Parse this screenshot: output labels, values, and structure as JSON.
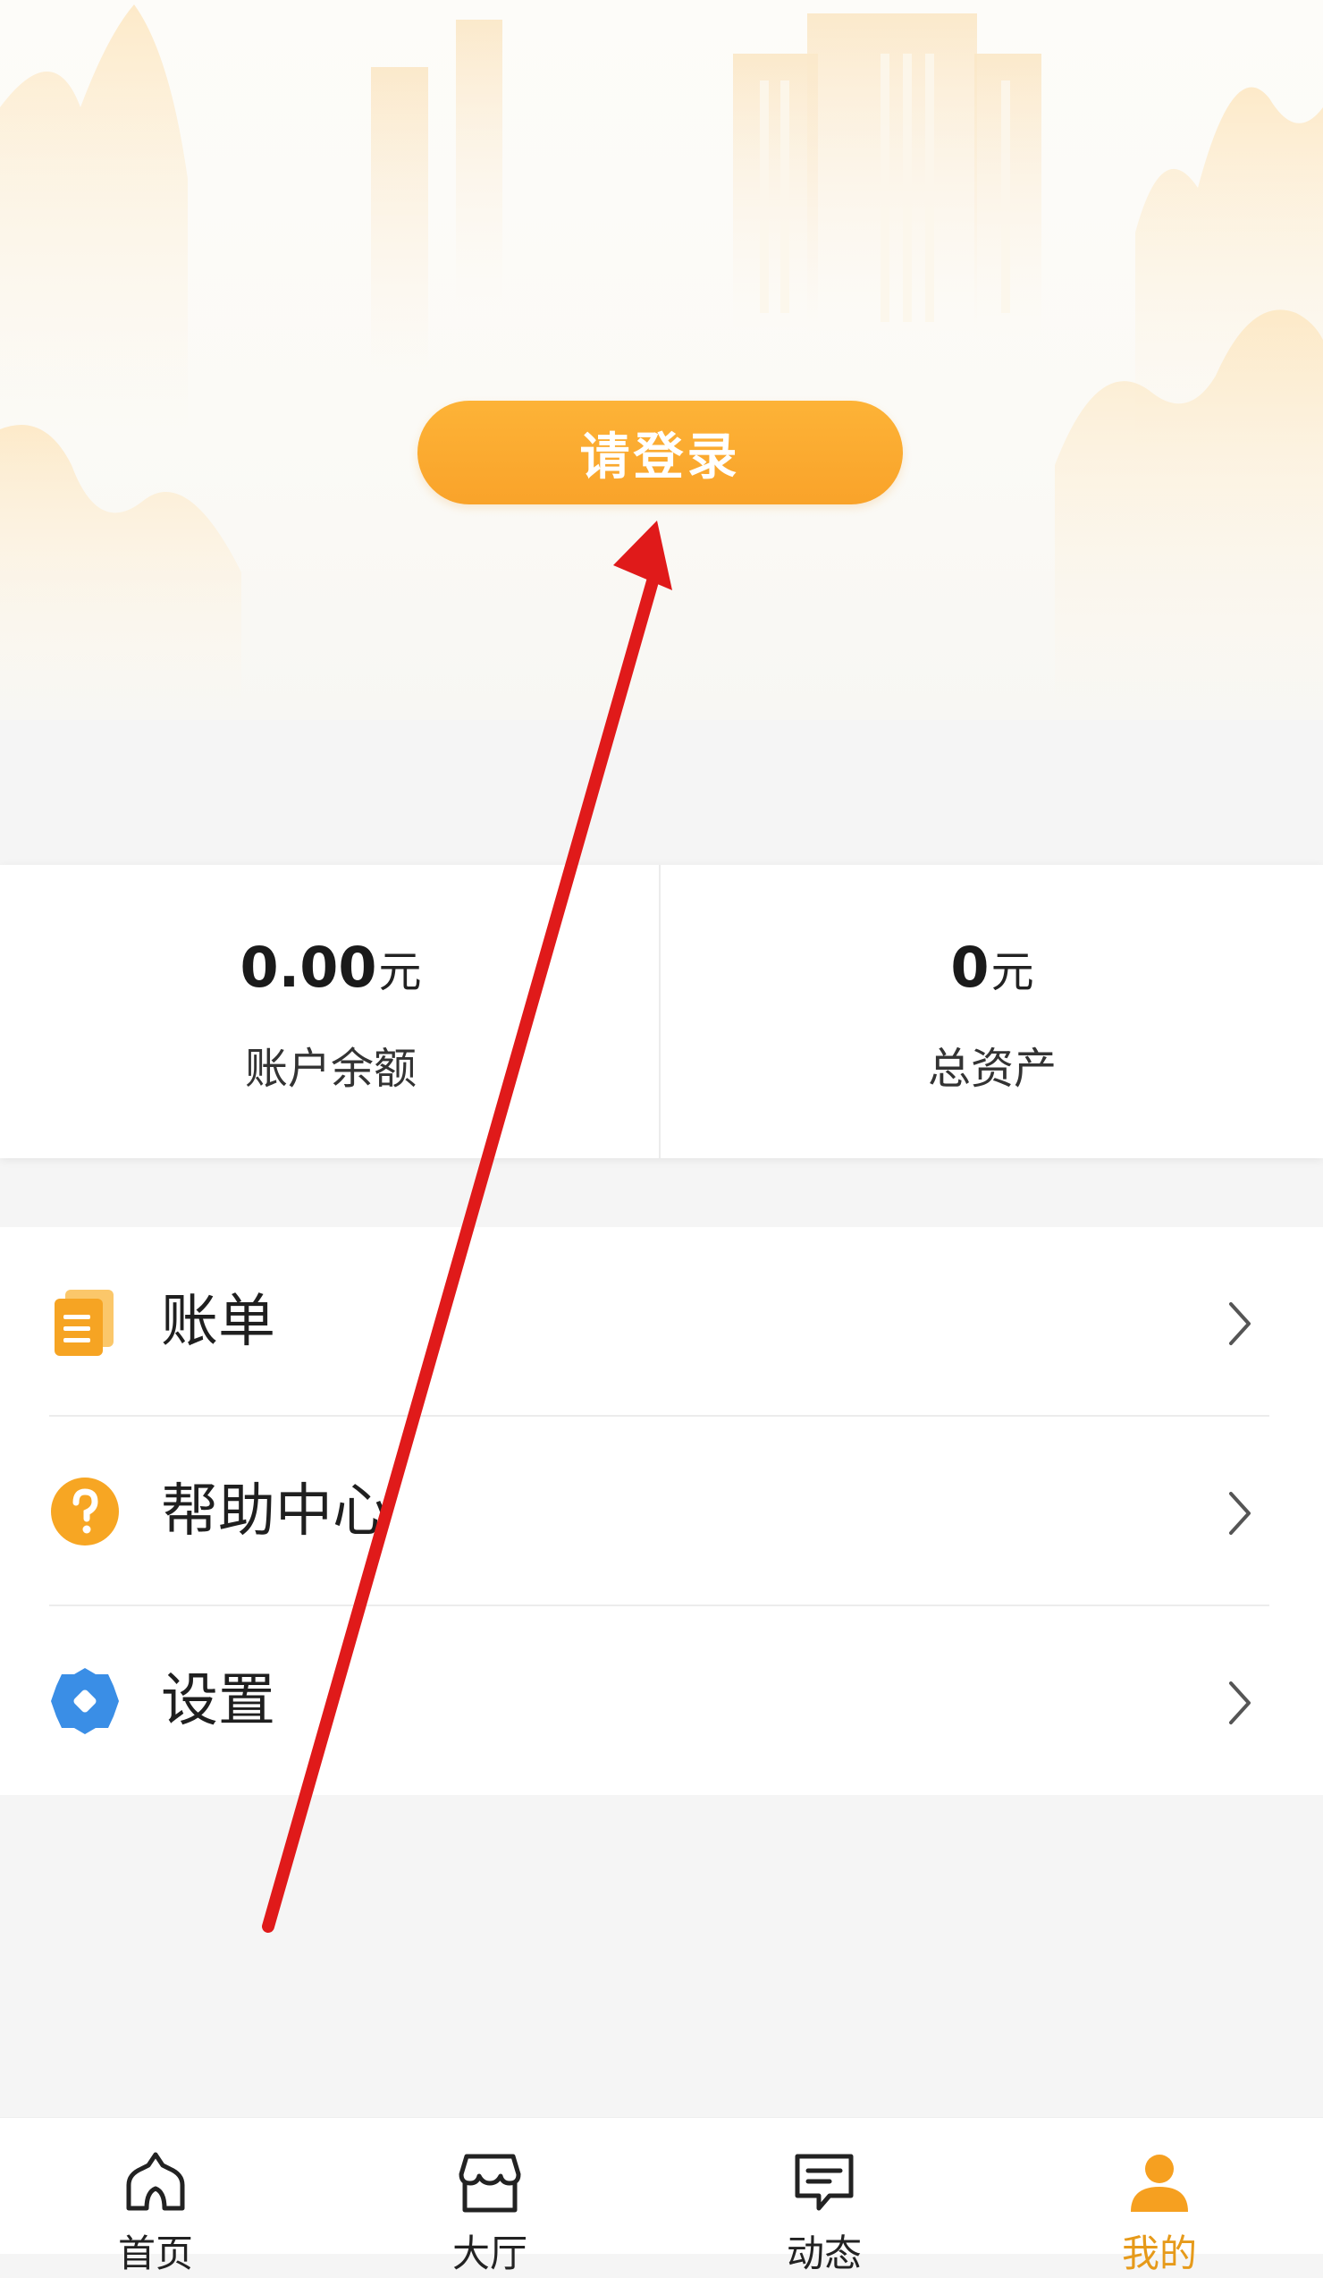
{
  "header": {
    "login_label": "请登录"
  },
  "stats": {
    "balance": {
      "value": "0.00",
      "unit": "元",
      "label": "账户余额"
    },
    "assets": {
      "value": "0",
      "unit": "元",
      "label": "总资产"
    }
  },
  "menu": {
    "items": [
      {
        "label": "账单",
        "icon": "bill-icon"
      },
      {
        "label": "帮助中心",
        "icon": "help-icon"
      },
      {
        "label": "设置",
        "icon": "settings-icon"
      }
    ]
  },
  "tabbar": {
    "items": [
      {
        "label": "首页",
        "icon": "home-icon"
      },
      {
        "label": "大厅",
        "icon": "store-icon"
      },
      {
        "label": "动态",
        "icon": "message-icon"
      },
      {
        "label": "我的",
        "icon": "user-icon",
        "active": true
      }
    ]
  },
  "colors": {
    "accent": "#f9a32a",
    "active_tab": "#e69a1a",
    "settings_icon": "#3a8ee6",
    "annotation_arrow": "#e01a1a"
  }
}
